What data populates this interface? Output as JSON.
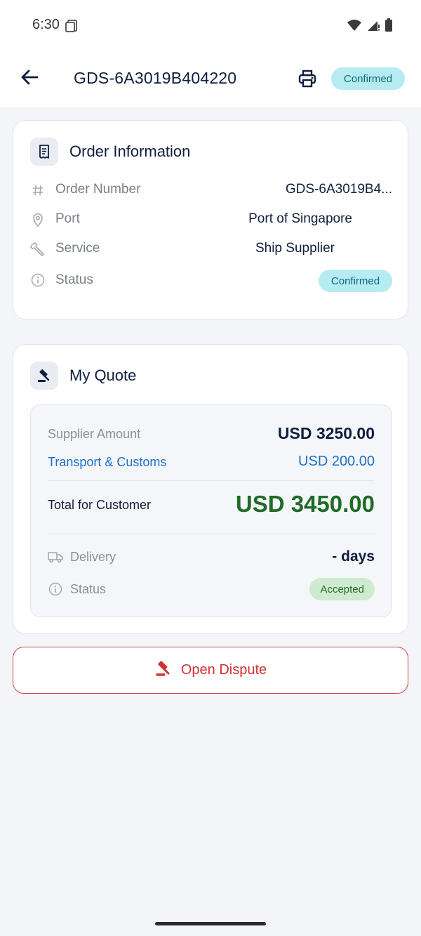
{
  "status_bar": {
    "time": "6:30"
  },
  "app_bar": {
    "title": "GDS-6A3019B404220",
    "status_badge": "Confirmed"
  },
  "order_info": {
    "title": "Order Information",
    "rows": [
      {
        "label": "Order Number",
        "value": "GDS-6A3019B4...",
        "icon": "hash-icon"
      },
      {
        "label": "Port",
        "value": "Port of Singapore",
        "icon": "location-pin-icon"
      },
      {
        "label": "Service",
        "value": "Ship Supplier",
        "icon": "wrench-icon"
      },
      {
        "label": "Status",
        "value": "Confirmed",
        "icon": "info-icon"
      }
    ]
  },
  "quote": {
    "title": "My Quote",
    "supplier_label": "Supplier Amount",
    "supplier_value": "USD 3250.00",
    "transport_label": "Transport & Customs",
    "transport_value": "USD 200.00",
    "total_label": "Total for Customer",
    "total_value": "USD 3450.00",
    "delivery_label": "Delivery",
    "delivery_value": "- days",
    "status_label": "Status",
    "status_value": "Accepted"
  },
  "dispute": {
    "label": "Open Dispute"
  },
  "colors": {
    "primary_text": "#0f1e3d",
    "link_blue": "#1e6fc7",
    "total_green": "#1f6b28",
    "danger_red": "#d1312f",
    "confirmed_bg": "#b6ebf1",
    "accepted_bg": "#cdeccf",
    "background": "#f4f5f9"
  }
}
